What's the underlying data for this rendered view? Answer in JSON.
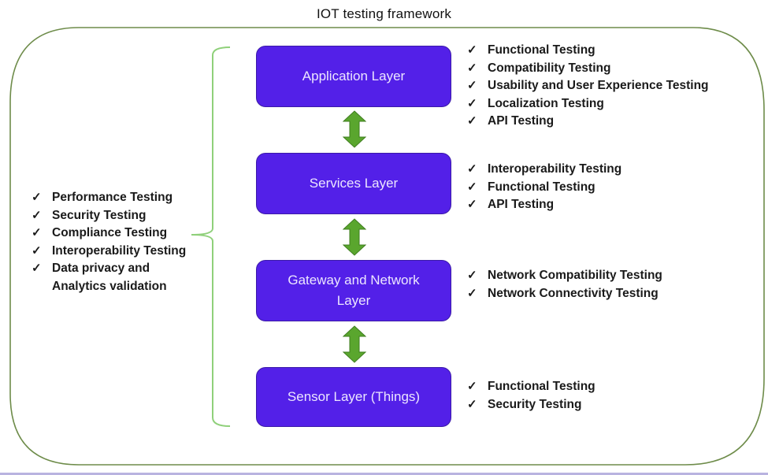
{
  "title": "IOT testing framework",
  "colors": {
    "layer_fill": "#5320e8",
    "layer_text": "#ece6ff",
    "arrow_fill": "#5aa62e",
    "frame_stroke": "#6e8c4a",
    "brace_stroke": "#8fd07a"
  },
  "icons": {
    "check": "✓"
  },
  "layers": [
    {
      "label": "Application Layer",
      "tests": [
        "Functional Testing",
        "Compatibility Testing",
        "Usability and User Experience Testing",
        "Localization Testing",
        "API Testing"
      ]
    },
    {
      "label": "Services Layer",
      "tests": [
        "Interoperability Testing",
        "Functional Testing",
        "API Testing"
      ]
    },
    {
      "label": "Gateway and Network Layer",
      "tests": [
        "Network Compatibility Testing",
        "Network Connectivity Testing"
      ]
    },
    {
      "label": "Sensor Layer (Things)",
      "tests": [
        "Functional Testing",
        "Security Testing"
      ]
    }
  ],
  "cross_cutting_tests": [
    "Performance Testing",
    "Security Testing",
    "Compliance Testing",
    "Interoperability Testing",
    "Data privacy and Analytics validation"
  ]
}
